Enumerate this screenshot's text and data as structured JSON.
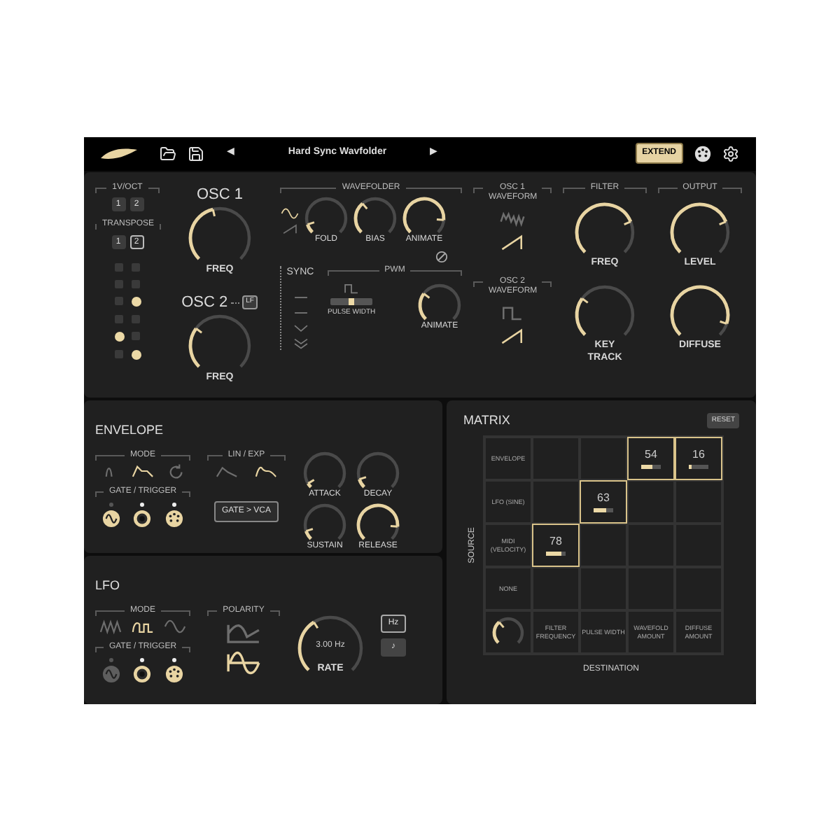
{
  "toolbar": {
    "prev": "◀",
    "preset": "Hard Sync Wavfolder",
    "next": "▶",
    "extend": "EXTEND"
  },
  "osc": {
    "voct": {
      "title": "1V/OCT",
      "buttons": [
        {
          "label": "1",
          "selected": false
        },
        {
          "label": "2",
          "selected": false
        }
      ]
    },
    "transpose": {
      "title": "TRANSPOSE",
      "buttons": [
        {
          "label": "1",
          "selected": false
        },
        {
          "label": "2",
          "selected": true
        }
      ]
    },
    "steps": [
      {
        "on": false
      },
      {
        "on": false
      },
      {
        "on": false
      },
      {
        "on": false
      },
      {
        "on": false
      },
      {
        "on": true
      },
      {
        "on": false
      },
      {
        "on": false
      },
      {
        "on": true
      },
      {
        "on": false
      },
      {
        "on": false
      },
      {
        "on": true
      }
    ],
    "osc1": {
      "title": "OSC 1",
      "knob": {
        "label": "FREQ"
      }
    },
    "osc2": {
      "title": "OSC 2",
      "badge": "LF",
      "knob": {
        "label": "FREQ"
      }
    },
    "sync": {
      "title": "SYNC",
      "options": [
        {
          "kind": "line"
        },
        {
          "kind": "line"
        },
        {
          "kind": "chevron"
        },
        {
          "kind": "double_chevron"
        }
      ]
    },
    "wavefolder": {
      "title": "WAVEFOLDER",
      "waves": [
        {
          "kind": "sine",
          "selected": true
        },
        {
          "kind": "ramp",
          "selected": false
        }
      ],
      "knobs": [
        {
          "label": "FOLD"
        },
        {
          "label": "BIAS"
        },
        {
          "label": "ANIMATE"
        }
      ]
    },
    "pwm": {
      "title": "PWM",
      "slider": {
        "label": "PULSE WIDTH",
        "level": 0.5
      },
      "knob": {
        "label": "ANIMATE"
      }
    },
    "osc1_waveform": {
      "title": "OSC 1 WAVEFORM",
      "waves": [
        {
          "kind": "fold",
          "selected": false
        },
        {
          "kind": "saw",
          "selected": true
        }
      ]
    },
    "osc2_waveform": {
      "title": "OSC 2 WAVEFORM",
      "waves": [
        {
          "kind": "square",
          "selected": false
        },
        {
          "kind": "saw",
          "selected": true
        }
      ]
    },
    "filter": {
      "title": "FILTER",
      "knobs": [
        {
          "label": "FREQ"
        },
        {
          "label": "KEY TRACK"
        }
      ]
    },
    "output": {
      "title": "OUTPUT",
      "knobs": [
        {
          "label": "LEVEL"
        },
        {
          "label": "DIFFUSE"
        }
      ]
    }
  },
  "envelope": {
    "title": "ENVELOPE",
    "mode": {
      "title": "MODE",
      "options": [
        {
          "kind": "pulse",
          "selected": false
        },
        {
          "kind": "adsr",
          "selected": true
        },
        {
          "kind": "loop",
          "selected": false
        }
      ]
    },
    "curve": {
      "title": "LIN / EXP",
      "options": [
        {
          "kind": "linear_env",
          "selected": false
        },
        {
          "kind": "exp_env",
          "selected": true
        }
      ]
    },
    "gate": {
      "title": "GATE / TRIGGER",
      "jacks": [
        {
          "kind": "wave",
          "enabled": true,
          "active": false
        },
        {
          "kind": "socket",
          "enabled": true,
          "active": true
        },
        {
          "kind": "midi",
          "enabled": true,
          "active": true
        }
      ]
    },
    "route": "GATE > VCA",
    "knobs": [
      {
        "label": "ATTACK"
      },
      {
        "label": "DECAY"
      },
      {
        "label": "SUSTAIN"
      },
      {
        "label": "RELEASE"
      }
    ]
  },
  "lfo": {
    "title": "LFO",
    "mode": {
      "title": "MODE",
      "options": [
        {
          "kind": "triangle",
          "selected": false
        },
        {
          "kind": "ramp_square",
          "selected": true
        },
        {
          "kind": "sine",
          "selected": false
        }
      ]
    },
    "polarity": {
      "title": "POLARITY",
      "options": [
        {
          "kind": "unipolar",
          "selected": false
        },
        {
          "kind": "bipolar",
          "selected": true
        }
      ]
    },
    "gate": {
      "title": "GATE / TRIGGER",
      "jacks": [
        {
          "kind": "wave",
          "enabled": false,
          "active": false
        },
        {
          "kind": "socket",
          "enabled": true,
          "active": true
        },
        {
          "kind": "midi",
          "enabled": true,
          "active": true
        }
      ]
    },
    "rate": {
      "label": "RATE",
      "value": "3.00 Hz"
    },
    "units": [
      {
        "label": "Hz",
        "selected": true
      },
      {
        "label": "♪",
        "selected": false
      }
    ]
  },
  "matrix": {
    "title": "MATRIX",
    "reset": "RESET",
    "source_axis": "SOURCE",
    "destination_axis": "DESTINATION",
    "sources": [
      {
        "label": "ENVELOPE",
        "cells": [
          {
            "active": false
          },
          {
            "active": false
          },
          {
            "active": true,
            "value": "54",
            "level": 0.54
          },
          {
            "active": true,
            "value": "16",
            "level": 0.16
          }
        ]
      },
      {
        "label": "LFO (SINE)",
        "cells": [
          {
            "active": false
          },
          {
            "active": true,
            "value": "63",
            "level": 0.63
          },
          {
            "active": false
          },
          {
            "active": false
          }
        ]
      },
      {
        "label": "MIDI (VELOCITY)",
        "cells": [
          {
            "active": true,
            "value": "78",
            "level": 0.78
          },
          {
            "active": false
          },
          {
            "active": false
          },
          {
            "active": false
          }
        ]
      },
      {
        "label": "NONE",
        "cells": [
          {
            "active": false
          },
          {
            "active": false
          },
          {
            "active": false
          },
          {
            "active": false
          }
        ]
      }
    ],
    "destinations": [
      "FILTER FREQUENCY",
      "PULSE WIDTH",
      "WAVEFOLD AMOUNT",
      "DIFFUSE AMOUNT"
    ]
  }
}
